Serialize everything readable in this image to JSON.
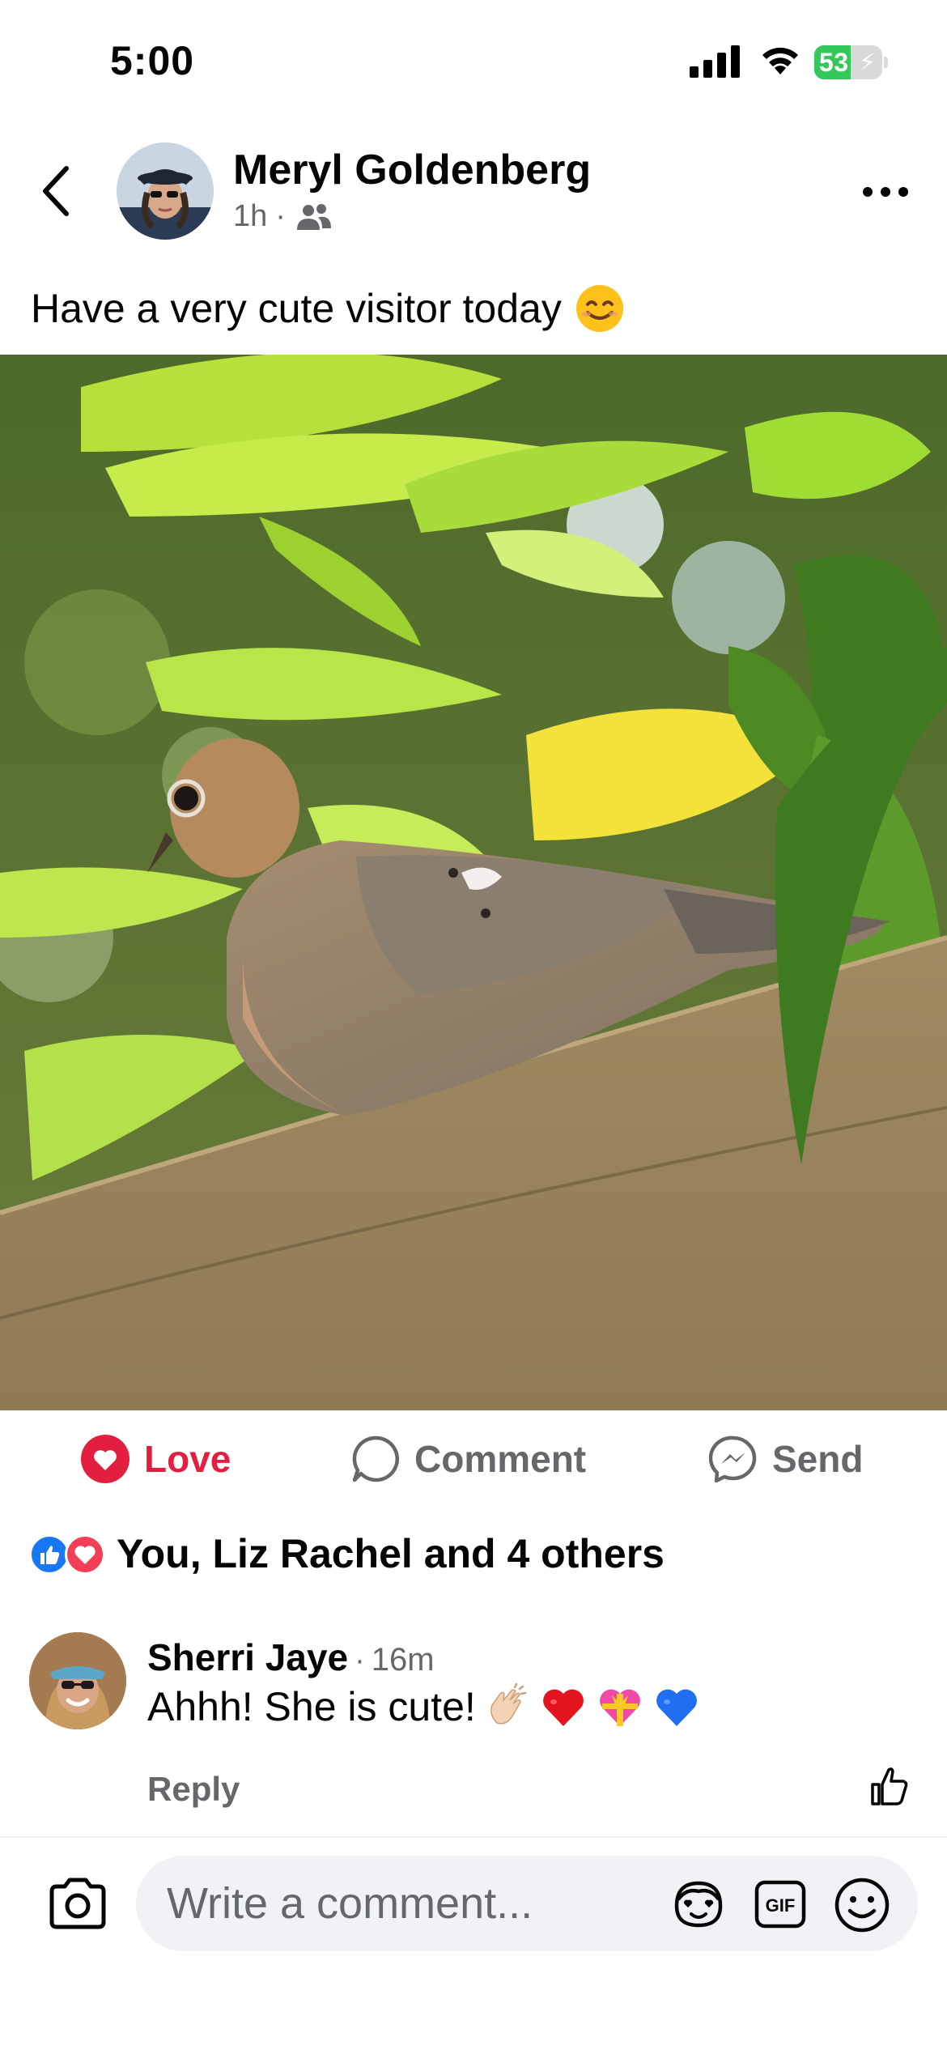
{
  "status_bar": {
    "time": "5:00",
    "battery_percent": "53",
    "battery_level": 0.53,
    "icons": [
      "signal-icon",
      "wifi-icon",
      "battery-charging-icon"
    ]
  },
  "post": {
    "author": "Meryl Goldenberg",
    "time": "1h",
    "separator": "·",
    "audience_icon": "friends-icon",
    "text": "Have a very cute visitor today",
    "text_emoji": "smiling-face-icon",
    "photo_icon": "photo-dove-on-fence"
  },
  "actions": {
    "love": "Love",
    "comment": "Comment",
    "send": "Send"
  },
  "reactions": {
    "icons": [
      "like-reaction-icon",
      "love-reaction-icon"
    ],
    "summary": "You, Liz Rachel and 4 others"
  },
  "comment": {
    "author": "Sherri Jaye",
    "separator": "·",
    "time": "16m",
    "text": "Ahhh! She is cute!",
    "emojis": [
      "clapping-hands-icon",
      "red-heart-icon",
      "heart-with-ribbon-icon",
      "blue-heart-icon"
    ],
    "reply_label": "Reply"
  },
  "composer": {
    "placeholder": "Write a comment...",
    "icons": [
      "camera-icon",
      "avatar-sticker-icon",
      "gif-icon",
      "emoji-icon"
    ]
  },
  "colors": {
    "love_red": "#e41e3f",
    "secondary_text": "#65676b",
    "like_blue": "#1877f2",
    "composer_bg": "#f0f2f5"
  }
}
